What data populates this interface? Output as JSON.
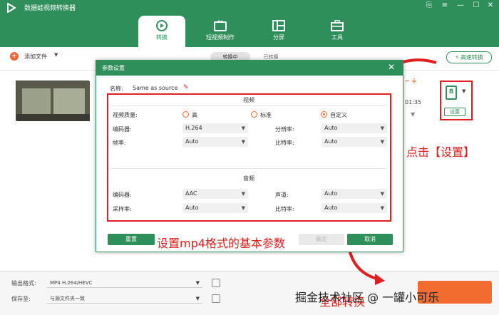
{
  "app": {
    "title": "数据蛙视频转换器"
  },
  "window_controls": [
    "⎘",
    "≡",
    "—",
    "☐",
    "✕"
  ],
  "nav": {
    "tabs": [
      {
        "label": "转换",
        "icon": "convert-icon",
        "active": true
      },
      {
        "label": "短视频制作",
        "icon": "tv-icon",
        "active": false
      },
      {
        "label": "分屏",
        "icon": "split-screen-icon",
        "active": false
      },
      {
        "label": "工具",
        "icon": "toolbox-icon",
        "active": false
      }
    ]
  },
  "toolbar": {
    "add_file": "添加文件",
    "segments": [
      "转换中",
      "已转换"
    ],
    "fast_convert": "高速转换"
  },
  "file_row": {
    "time_fragment": "01:35"
  },
  "settings_button": {
    "badge": "8",
    "label": "设置"
  },
  "annotations": {
    "click_settings": "点击【设置】",
    "set_params": "设置mp4格式的基本参数",
    "bottom": "全部转换"
  },
  "dialog": {
    "title": "参数设置",
    "name_label": "名称:",
    "name_value": "Same as source",
    "video_section": "视频",
    "audio_section": "音频",
    "video_quality_label": "视频质量:",
    "quality_options": [
      "高",
      "标准",
      "自定义"
    ],
    "quality_selected": "自定义",
    "video_encoder_label": "编码器:",
    "video_encoder_value": "H.264",
    "resolution_label": "分辨率:",
    "resolution_value": "Auto",
    "framerate_label": "帧率:",
    "framerate_value": "Auto",
    "video_bitrate_label": "比特率:",
    "video_bitrate_value": "Auto",
    "audio_encoder_label": "编码器:",
    "audio_encoder_value": "AAC",
    "channel_label": "声道:",
    "channel_value": "Auto",
    "samplerate_label": "采样率:",
    "samplerate_value": "Auto",
    "audio_bitrate_label": "比特率:",
    "audio_bitrate_value": "Auto",
    "reset_btn": "重置",
    "ok_btn": "确定",
    "cancel_btn": "取消"
  },
  "bottom": {
    "output_format_label": "输出格式:",
    "output_format_value": "MP4 H.264/HEVC",
    "save_to_label": "保存至:",
    "save_to_value": "与源文件夹一致"
  },
  "watermark": "掘金技术社区 @ 一罐小可乐",
  "colors": {
    "brand": "#2f8f5b",
    "accent": "#f26b2f",
    "annotation": "#e0201e"
  }
}
